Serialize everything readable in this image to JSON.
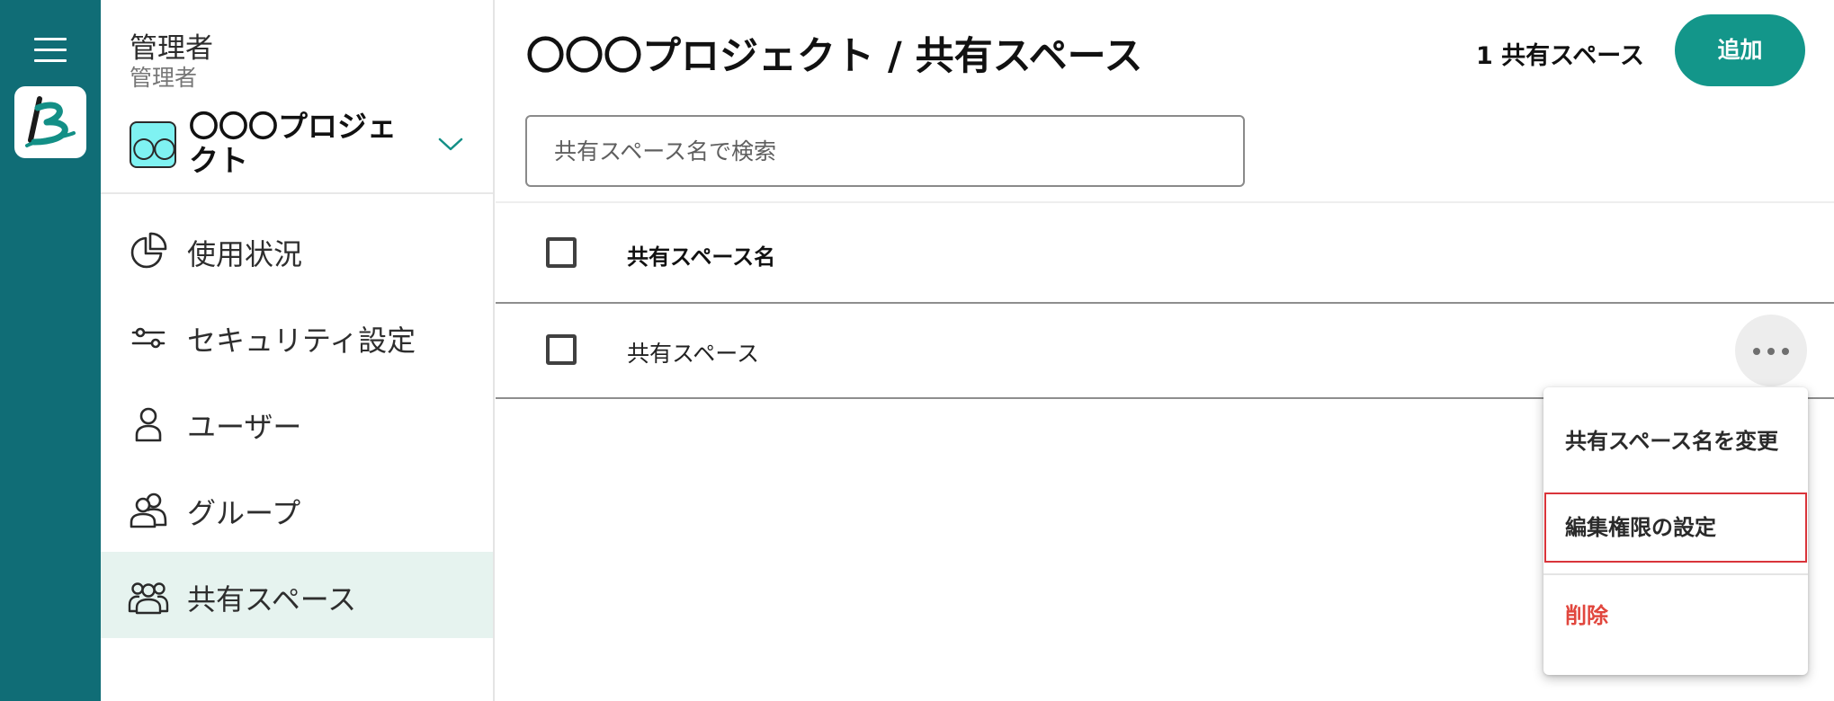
{
  "rail": {
    "menu_icon": "hamburger-menu-icon",
    "logo_icon": "app-logo-icon"
  },
  "sidebar": {
    "user_name": "管理者",
    "user_role": "管理者",
    "project": {
      "avatar_text": "〇〇",
      "avatar_color": "#7ff2f2",
      "name": "〇〇〇プロジェクト",
      "chevron_icon": "chevron-down-icon"
    },
    "items": [
      {
        "label": "使用状況",
        "icon": "pie-chart-icon",
        "active": false
      },
      {
        "label": "セキュリティ設定",
        "icon": "sliders-icon",
        "active": false
      },
      {
        "label": "ユーザー",
        "icon": "user-icon",
        "active": false
      },
      {
        "label": "グループ",
        "icon": "group-icon",
        "active": false
      },
      {
        "label": "共有スペース",
        "icon": "shared-space-icon",
        "active": true
      }
    ]
  },
  "main": {
    "title": "〇〇〇プロジェクト / 共有スペース",
    "count_text": "1 共有スペース",
    "add_label": "追加",
    "search_placeholder": "共有スペース名で検索",
    "table": {
      "column_header": "共有スペース名",
      "rows": [
        {
          "name": "共有スペース"
        }
      ]
    },
    "row_menu": {
      "items": [
        {
          "label": "共有スペース名を変更",
          "highlight": false,
          "danger": false
        },
        {
          "label": "編集権限の設定",
          "highlight": true,
          "danger": false
        },
        {
          "label": "削除",
          "highlight": false,
          "danger": true
        }
      ]
    }
  },
  "colors": {
    "rail": "#106d76",
    "accent": "#13968a",
    "active_item_bg": "#e6f3ef",
    "danger": "#e1463d",
    "highlight_border": "#d9343a"
  }
}
